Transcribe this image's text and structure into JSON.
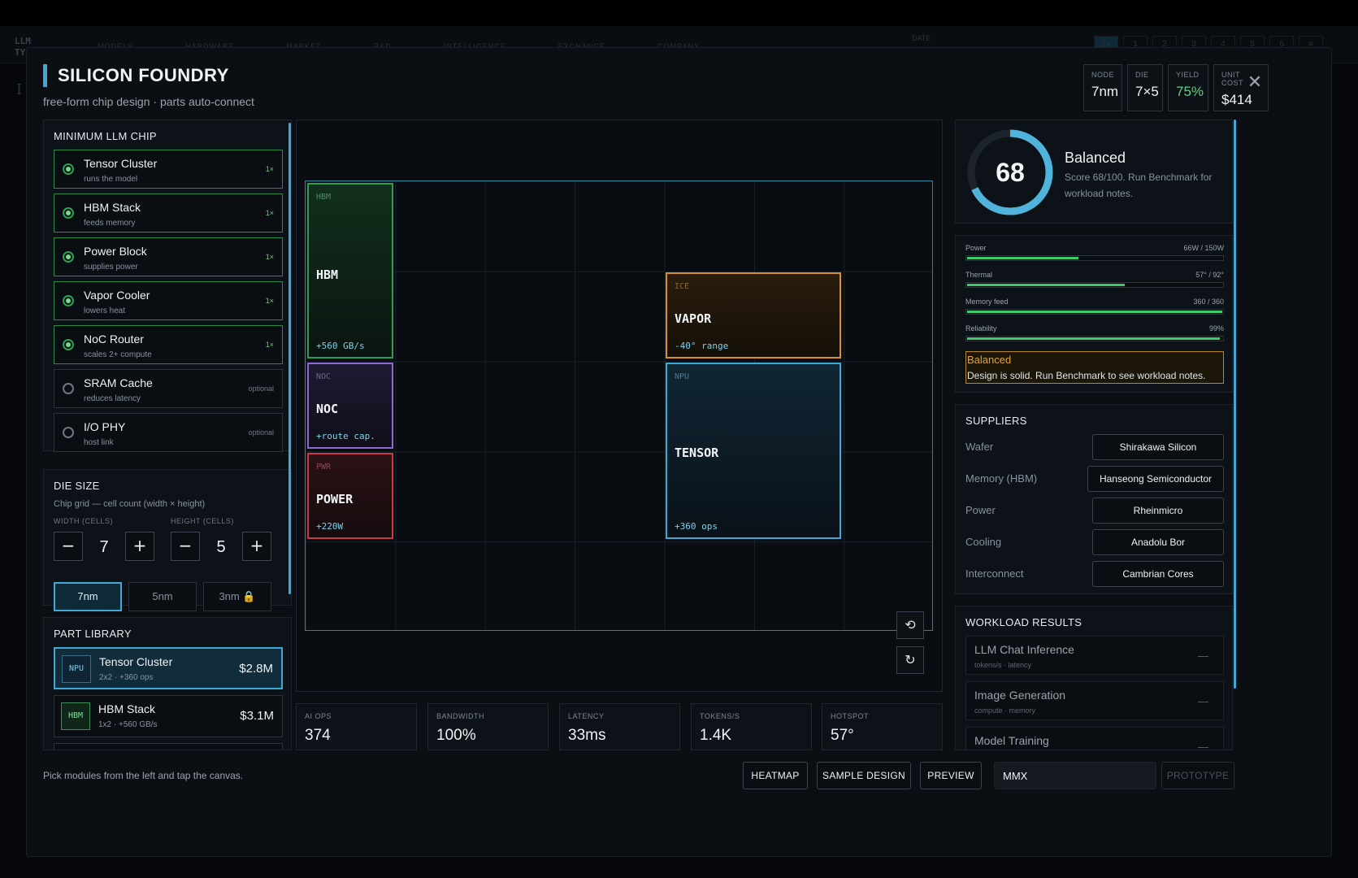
{
  "background": {
    "brand": "LLM TY",
    "nav": [
      "MODELS",
      "HARDWARE",
      "MARKET",
      "R&D",
      "INTELLIGENCE",
      "EXCHANGE",
      "COMPANY"
    ],
    "date_label": "DATE",
    "pages": [
      "1×",
      "1",
      "2",
      "3",
      "4",
      "5",
      "6",
      "≡"
    ],
    "mark": "I"
  },
  "modal": {
    "title": "SILICON FOUNDRY",
    "subtitle": "free-form chip design · parts auto-connect",
    "stats": [
      {
        "label": "NODE",
        "value": "7nm"
      },
      {
        "label": "DIE",
        "value": "7×5"
      },
      {
        "label": "YIELD",
        "value": "75%"
      },
      {
        "label": "UNIT COST",
        "value": "$414"
      }
    ],
    "close_icon": "✕"
  },
  "requirements": {
    "title": "MINIMUM LLM CHIP",
    "items": [
      {
        "name": "Tensor Cluster",
        "desc": "runs the model",
        "tag": "1×",
        "done": true
      },
      {
        "name": "HBM Stack",
        "desc": "feeds memory",
        "tag": "1×",
        "done": true
      },
      {
        "name": "Power Block",
        "desc": "supplies power",
        "tag": "1×",
        "done": true
      },
      {
        "name": "Vapor Cooler",
        "desc": "lowers heat",
        "tag": "1×",
        "done": true
      },
      {
        "name": "NoC Router",
        "desc": "scales 2+ compute",
        "tag": "1×",
        "done": true
      },
      {
        "name": "SRAM Cache",
        "desc": "reduces latency",
        "tag": "optional",
        "done": false
      },
      {
        "name": "I/O PHY",
        "desc": "host link",
        "tag": "optional",
        "done": false
      }
    ]
  },
  "die_size": {
    "title": "DIE SIZE",
    "desc": "Chip grid — cell count (width × height)",
    "width_label": "WIDTH (CELLS)",
    "height_label": "HEIGHT (CELLS)",
    "width": "7",
    "height": "5",
    "minus": "−",
    "plus": "+",
    "nodes": [
      {
        "label": "7nm",
        "active": true,
        "locked": false
      },
      {
        "label": "5nm",
        "active": false,
        "locked": false
      },
      {
        "label": "3nm 🔒",
        "active": false,
        "locked": true
      }
    ]
  },
  "library": {
    "title": "PART LIBRARY",
    "items": [
      {
        "badge": "NPU",
        "name": "Tensor Cluster",
        "desc": "2x2 · +360 ops",
        "price": "$2.8M"
      },
      {
        "badge": "HBM",
        "name": "HBM Stack",
        "desc": "1x2 · +560 GB/s",
        "price": "$3.1M"
      }
    ]
  },
  "canvas": {
    "modules": [
      {
        "tag": "HBM",
        "name": "HBM",
        "stat": "+560 GB/s"
      },
      {
        "tag": "ICE",
        "name": "VAPOR",
        "stat": "-40° range"
      },
      {
        "tag": "NOC",
        "name": "NOC",
        "stat": "+route cap."
      },
      {
        "tag": "PWR",
        "name": "POWER",
        "stat": "+220W"
      },
      {
        "tag": "NPU",
        "name": "TENSOR",
        "stat": "+360 ops"
      }
    ],
    "rotate_icon": "⟲",
    "reset_icon": "↻"
  },
  "metrics": [
    {
      "label": "AI OPS",
      "value": "374"
    },
    {
      "label": "BANDWIDTH",
      "value": "100%"
    },
    {
      "label": "LATENCY",
      "value": "33ms"
    },
    {
      "label": "TOKENS/S",
      "value": "1.4K"
    },
    {
      "label": "HOTSPOT",
      "value": "57°"
    }
  ],
  "score": {
    "value": "68",
    "fraction": 0.68,
    "label": "Balanced",
    "desc": "Score 68/100. Run Benchmark for workload notes.",
    "ring_color": "#4fb3db"
  },
  "bars": [
    {
      "label": "Power",
      "value": "66W / 150W",
      "fill": 0.44
    },
    {
      "label": "Thermal",
      "value": "57° / 92°",
      "fill": 0.62
    },
    {
      "label": "Memory feed",
      "value": "360 / 360",
      "fill": 1.0
    },
    {
      "label": "Reliability",
      "value": "99%",
      "fill": 0.99
    }
  ],
  "note": {
    "title": "Balanced",
    "desc": "Design is solid. Run Benchmark to see workload notes."
  },
  "suppliers": {
    "title": "SUPPLIERS",
    "items": [
      {
        "key": "Wafer",
        "value": "Shirakawa Silicon"
      },
      {
        "key": "Memory (HBM)",
        "value": "Hanseong Semiconductor"
      },
      {
        "key": "Power",
        "value": "Rheinmicro"
      },
      {
        "key": "Cooling",
        "value": "Anadolu Bor"
      },
      {
        "key": "Interconnect",
        "value": "Cambrian Cores"
      }
    ]
  },
  "workloads": {
    "title": "WORKLOAD RESULTS",
    "items": [
      {
        "name": "LLM Chat Inference",
        "desc": "tokens/s · latency",
        "score": "—"
      },
      {
        "name": "Image Generation",
        "desc": "compute · memory",
        "score": "—"
      },
      {
        "name": "Model Training",
        "desc": "",
        "score": "—"
      }
    ]
  },
  "footer": {
    "hint": "Pick modules from the left and tap the canvas.",
    "heatmap": "HEATMAP",
    "sample": "SAMPLE DESIGN",
    "preview": "PREVIEW",
    "name_value": "MMX",
    "prototype": "PROTOTYPE"
  }
}
